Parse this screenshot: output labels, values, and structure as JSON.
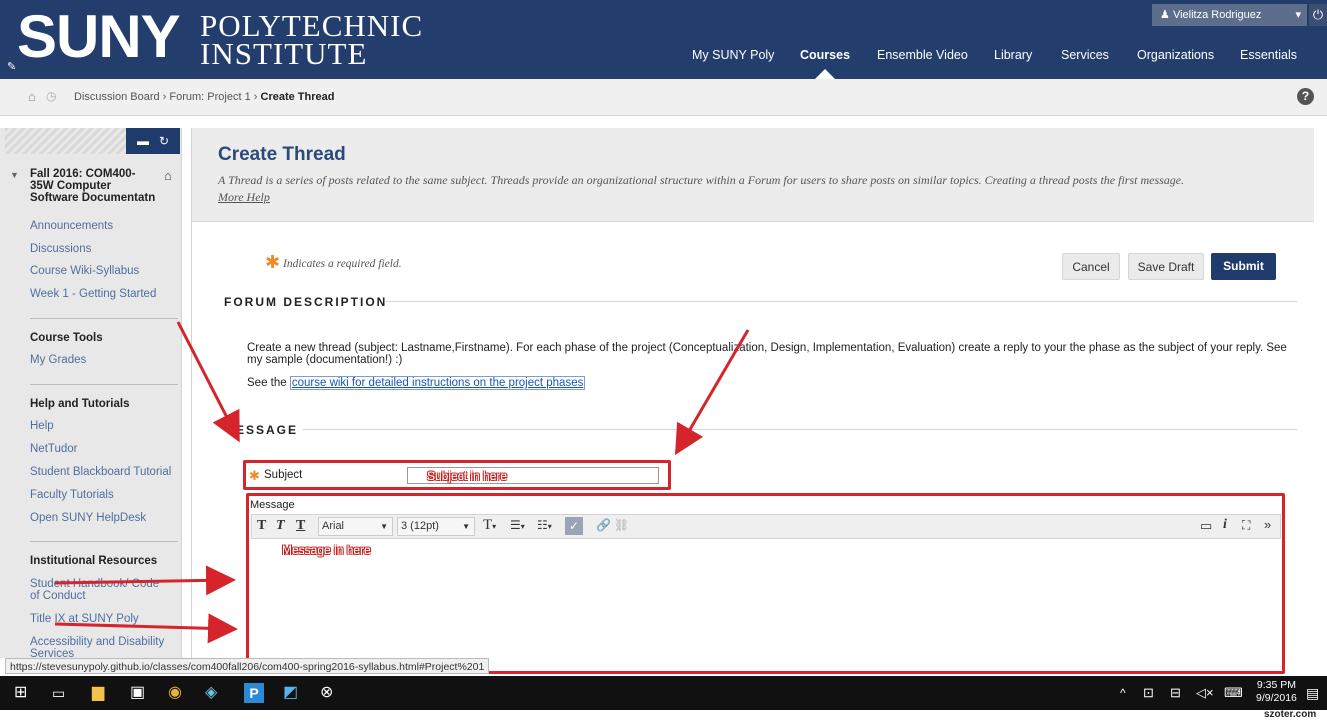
{
  "header": {
    "logo_suny": "SUNY",
    "logo_line1": "POLYTECHNIC",
    "logo_line2": "INSTITUTE",
    "user_name": "Vielitza Rodriguez",
    "nav": [
      "My SUNY Poly",
      "Courses",
      "Ensemble Video",
      "Library",
      "Services",
      "Organizations",
      "Essentials"
    ],
    "active_nav": "Courses"
  },
  "breadcrumb": {
    "items": [
      "Discussion Board",
      "Forum: Project 1",
      "Create Thread"
    ],
    "sep": "›"
  },
  "sidebar": {
    "course_title": "Fall 2016: COM400-35W Computer Software Documentatn",
    "course_items": [
      "Announcements",
      "Discussions",
      "Course Wiki-Syllabus",
      "Week 1 - Getting Started"
    ],
    "tools_heading": "Course Tools",
    "tools_items": [
      "My Grades"
    ],
    "help_heading": "Help and Tutorials",
    "help_items": [
      "Help",
      "NetTudor",
      "Student Blackboard Tutorial",
      "Faculty Tutorials",
      "Open SUNY HelpDesk"
    ],
    "inst_heading": "Institutional Resources",
    "inst_items": [
      "Student Handbook/ Code of Conduct",
      "Title IX at SUNY Poly",
      "Accessibility and Disability Services"
    ]
  },
  "page": {
    "title": "Create Thread",
    "subtitle": "A Thread is a series of posts related to the same subject. Threads provide an organizational structure within a Forum for users to share posts on similar topics. Creating a thread posts the first message.",
    "more_help": "More Help",
    "required_note": "Indicates a required field.",
    "cancel": "Cancel",
    "save_draft": "Save Draft",
    "submit": "Submit",
    "forum_desc_heading": "FORUM DESCRIPTION",
    "forum_desc_text": "Create a new thread (subject: Lastname,Firstname). For each phase of the project (Conceptualization, Design, Implementation, Evaluation) create a reply to your the phase as the subject of your reply. See my sample (documentation!) :)",
    "see_the": "See the",
    "wiki_link": "course wiki for detailed instructions on the project phases",
    "message_heading": "ESSAGE",
    "subject_label": "Subject",
    "subject_annotation": "Subject in here",
    "message_label": "Message",
    "font_family": "Arial",
    "font_size": "3 (12pt)",
    "message_annotation": "Message in here"
  },
  "status_url": "https://stevesunypoly.github.io/classes/com400fall20",
  "status_url_tail": "6/com400-spring2016-syllabus.html#Project%201",
  "taskbar": {
    "time": "9:35 PM",
    "date": "9/9/2016"
  },
  "watermark": "szoter.com",
  "colors": {
    "header_bg": "#233d6d",
    "submit_bg": "#1f3b6b",
    "annotation_red": "#d5242b",
    "link_blue": "#4d6f9e"
  }
}
